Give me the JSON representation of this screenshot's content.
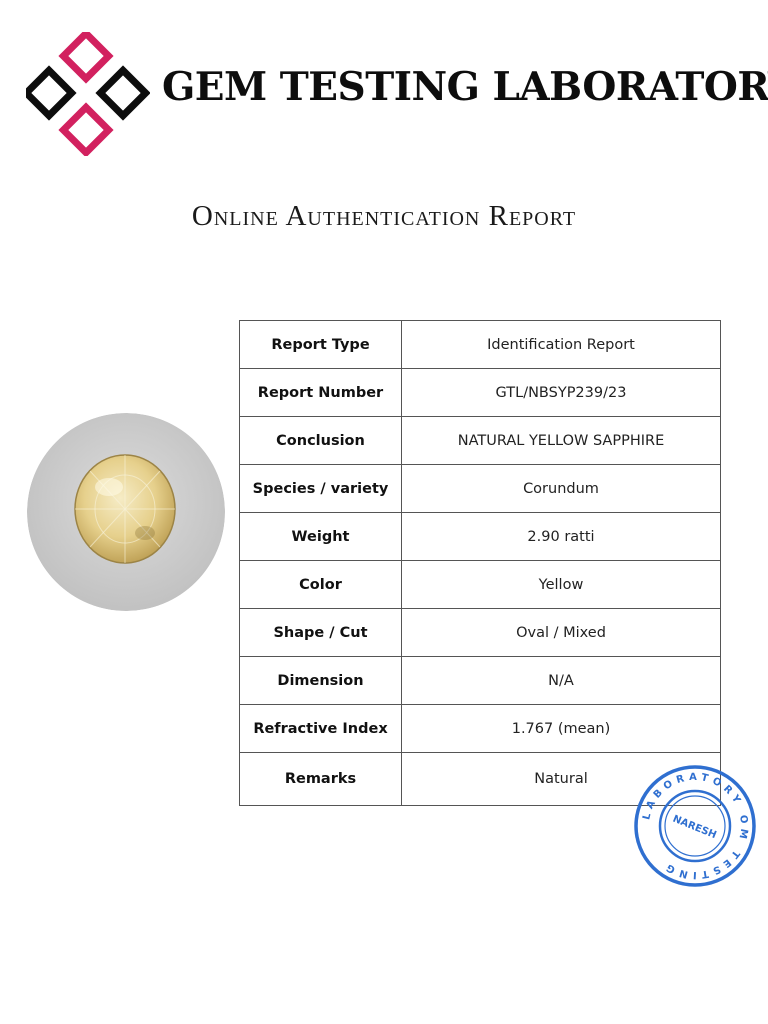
{
  "header": {
    "brand": "GEM TESTING LABORATORY",
    "logo_icon": "diamond-grid-icon",
    "colors": {
      "accent": "#d2215f",
      "dark": "#0d0d0d"
    }
  },
  "subtitle": "Online Authentication Report",
  "report": {
    "rows": [
      {
        "label": "Report Type",
        "value": "Identification Report"
      },
      {
        "label": "Report Number",
        "value": "GTL/NBSYP239/23"
      },
      {
        "label": "Conclusion",
        "value": "NATURAL YELLOW SAPPHIRE"
      },
      {
        "label": "Species / variety",
        "value": "Corundum"
      },
      {
        "label": "Weight",
        "value": "2.90 ratti"
      },
      {
        "label": "Color",
        "value": "Yellow"
      },
      {
        "label": "Shape / Cut",
        "value": "Oval / Mixed"
      },
      {
        "label": "Dimension",
        "value": "N/A"
      },
      {
        "label": "Refractive Index",
        "value": "1.767 (mean)"
      },
      {
        "label": "Remarks",
        "value": "Natural"
      }
    ]
  },
  "stamp": {
    "ring_text": "LABORATORY OM TESTING",
    "signature": "NARESH",
    "color": "#2f6fd0"
  }
}
